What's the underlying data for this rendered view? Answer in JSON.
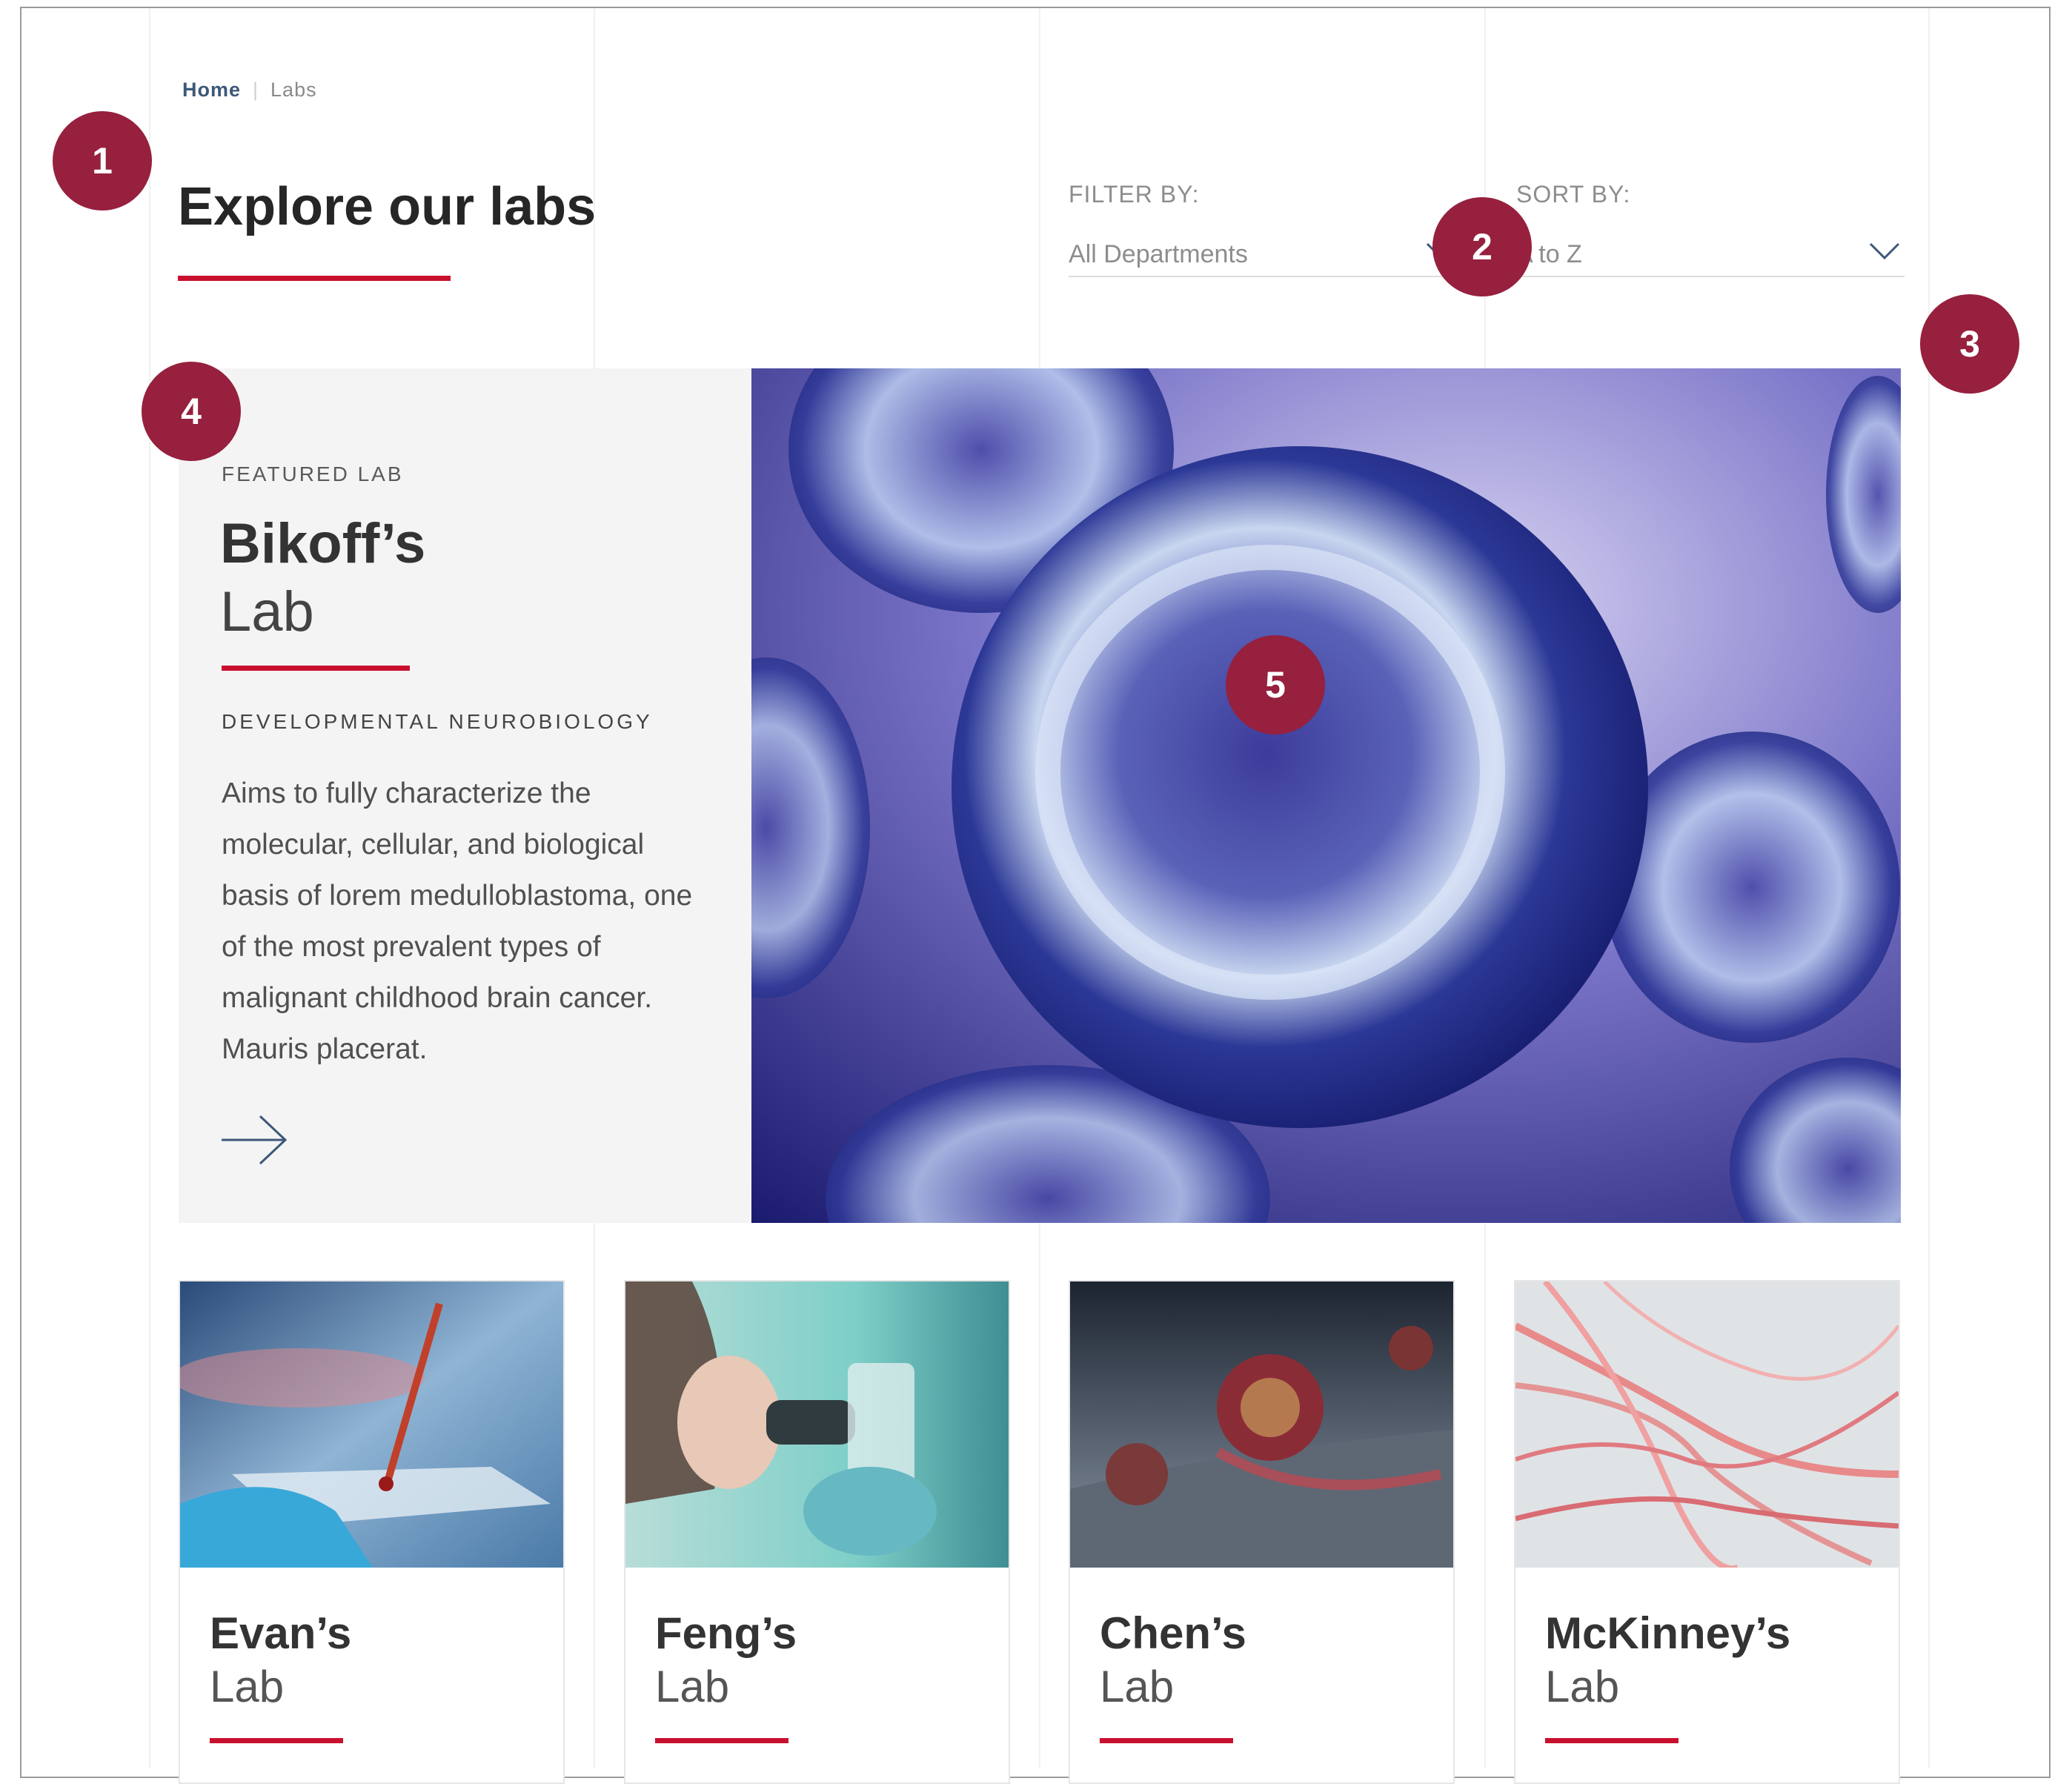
{
  "breadcrumb": {
    "home": "Home",
    "separator": "|",
    "current": "Labs"
  },
  "page": {
    "title": "Explore our labs"
  },
  "filter": {
    "label": "FILTER BY:",
    "value": "All Departments"
  },
  "sort": {
    "label": "SORT BY:",
    "value": "A to Z"
  },
  "featured": {
    "kicker": "FEATURED LAB",
    "name": "Bikoff’s",
    "lab": "Lab",
    "department": "DEVELOPMENTAL NEUROBIOLOGY",
    "description": "Aims to fully characterize the molecular, cellular, and biological basis of lorem medulloblastoma, one of the most prevalent types of malignant childhood brain cancer. Mauris placerat."
  },
  "cards": [
    {
      "name": "Evan’s",
      "lab": "Lab"
    },
    {
      "name": "Feng’s",
      "lab": "Lab"
    },
    {
      "name": "Chen’s",
      "lab": "Lab"
    },
    {
      "name": "McKinney’s",
      "lab": "Lab"
    }
  ],
  "annotations": [
    "1",
    "2",
    "3",
    "4",
    "5"
  ],
  "colors": {
    "accent": "#c8102e",
    "marker": "#96203e",
    "link": "#3c5878",
    "panel": "#f4f4f4"
  }
}
